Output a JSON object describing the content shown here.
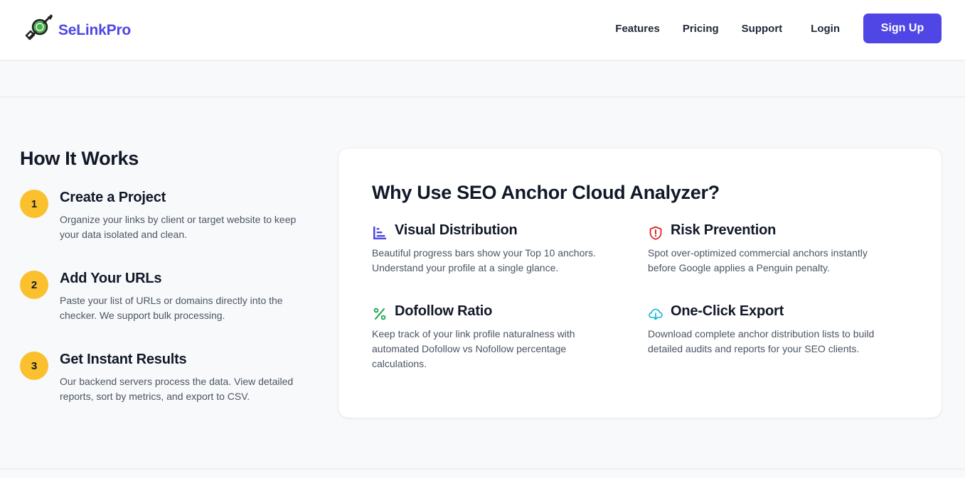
{
  "brand": {
    "name": "SeLinkPro",
    "logo_icon": "link-chain-icon",
    "accent": "#4f46e5"
  },
  "nav": {
    "items": [
      {
        "label": "Features"
      },
      {
        "label": "Pricing"
      },
      {
        "label": "Support"
      },
      {
        "label": "Login"
      }
    ],
    "signup_label": "Sign Up"
  },
  "how_it_works": {
    "title": "How It Works",
    "badge_color": "#fbc02d",
    "steps": [
      {
        "number": "1",
        "title": "Create a Project",
        "description": "Organize your links by client or target website to keep your data isolated and clean."
      },
      {
        "number": "2",
        "title": "Add Your URLs",
        "description": "Paste your list of URLs or domains directly into the checker. We support bulk processing."
      },
      {
        "number": "3",
        "title": "Get Instant Results",
        "description": "Our backend servers process the data. View detailed reports, sort by metrics, and export to CSV."
      }
    ]
  },
  "why_use": {
    "title": "Why Use SEO Anchor Cloud Analyzer?",
    "features": [
      {
        "icon": "bar-chart-icon",
        "icon_color": "#4f46e5",
        "title": "Visual Distribution",
        "description": "Beautiful progress bars show your Top 10 anchors. Understand your profile at a single glance."
      },
      {
        "icon": "shield-alert-icon",
        "icon_color": "#dc2626",
        "title": "Risk Prevention",
        "description": "Spot over-optimized commercial anchors instantly before Google applies a Penguin penalty."
      },
      {
        "icon": "percent-icon",
        "icon_color": "#16a34a",
        "title": "Dofollow Ratio",
        "description": "Keep track of your link profile naturalness with automated Dofollow vs Nofollow percentage calculations."
      },
      {
        "icon": "cloud-download-icon",
        "icon_color": "#06b6d4",
        "title": "One-Click Export",
        "description": "Download complete anchor distribution lists to build detailed audits and reports for your SEO clients."
      }
    ]
  }
}
